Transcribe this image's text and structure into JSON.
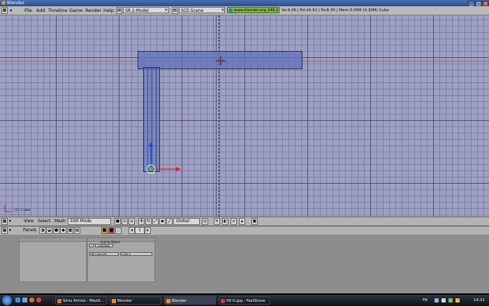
{
  "window": {
    "title": "Blender"
  },
  "menu": [
    "File",
    "Add",
    "Timeline",
    "Game",
    "Render",
    "Help"
  ],
  "screen_field": "SR:2-Model",
  "scene_field": "SCE:Scene",
  "web_link": "www.blender.org 249.2",
  "stats": "Ve:9-26 | Ed:16-52 | Fa:8-30 | Mem:3.05M (0.30M) Cube",
  "viewport": {
    "object_label": "(1) Cube"
  },
  "header3d": {
    "view": "View",
    "select": "Select",
    "mesh": "Mesh",
    "mode": "Edit Mode",
    "orientation": "Global"
  },
  "buttons_header": {
    "panels": "Panels",
    "frame": "1"
  },
  "panel_b": {
    "link_label": "Link to Object",
    "add_new": "Add New",
    "mesh_field": "ME:Cube.002",
    "mat_field": "0 Mat 0"
  },
  "taskbar": {
    "tasks": [
      "Sims Artists - Mozill...",
      "Blender",
      "Blender",
      "09 G.jpg - FastStone"
    ],
    "lang": "FR",
    "clock": "14:31"
  },
  "colors": {
    "viewport_bg": "#9ea0c3",
    "selection": "#5f73be",
    "x_axis": "#c8585a",
    "arrow_x": "#e02020",
    "arrow_z": "#2040e0"
  }
}
